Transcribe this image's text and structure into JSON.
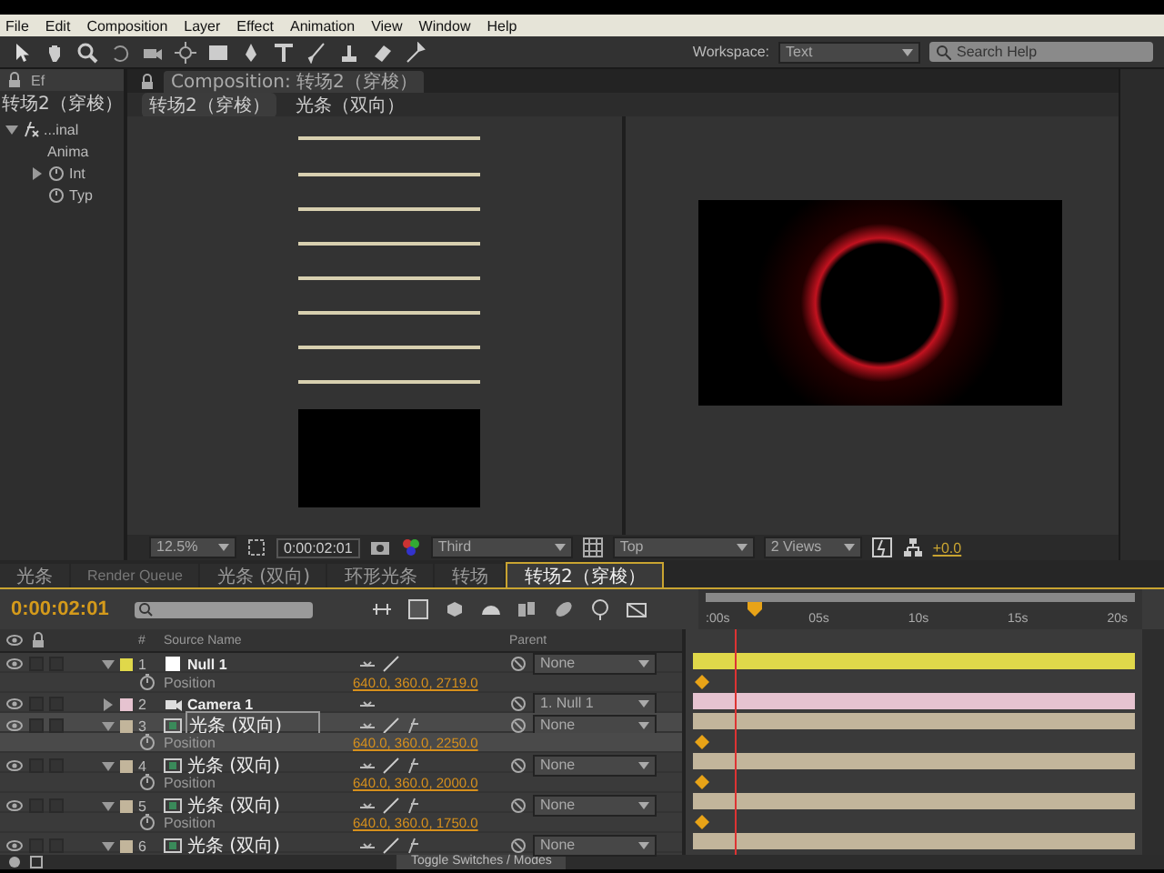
{
  "menu": [
    "File",
    "Edit",
    "Composition",
    "Layer",
    "Effect",
    "Animation",
    "View",
    "Window",
    "Help"
  ],
  "toolbar": {
    "workspace_label": "Workspace:",
    "workspace": "Text",
    "search_placeholder": "Search Help"
  },
  "effects_panel": {
    "tab": "Ef",
    "layer": "转场2（穿梭）",
    "tree": [
      {
        "label": "...inal",
        "kind": "effect",
        "expanded": true,
        "children": [
          {
            "label": "Anima",
            "kind": "group"
          },
          {
            "label": "Int",
            "kind": "property",
            "expanded": false
          },
          {
            "label": "Typ",
            "kind": "property"
          }
        ]
      }
    ]
  },
  "composition": {
    "tab": "Composition: 转场2（穿梭）",
    "breadcrumbs": [
      "转场2（穿梭）",
      "光条（双向）"
    ],
    "footer": {
      "zoom": "12.5%",
      "timecode": "0:00:02:01",
      "camera_view": "Third",
      "view": "Top",
      "layout": "2 Views",
      "exposure": "+0.0"
    }
  },
  "timeline_tabs": [
    {
      "label": "光条",
      "selected": false
    },
    {
      "label": "Render Queue",
      "selected": false
    },
    {
      "label": "光条 (双向)",
      "selected": false
    },
    {
      "label": "环形光条",
      "selected": false
    },
    {
      "label": "转场",
      "selected": false
    },
    {
      "label": "转场2（穿梭）",
      "selected": true
    }
  ],
  "timeline": {
    "current_time": "0:00:02:01",
    "ruler": [
      ":00s",
      "05s",
      "10s",
      "15s",
      "20s"
    ],
    "columns": {
      "number": "#",
      "source_name": "Source Name",
      "parent": "Parent"
    },
    "rows": [
      {
        "kind": "null_layer",
        "number": "1",
        "name": "Null 1",
        "color": "#e0d84a",
        "expanded": true,
        "selected": false,
        "parent": "None"
      },
      {
        "kind": "property",
        "name": "Position",
        "value": "640.0, 360.0, 2719.0",
        "keyframes": true,
        "selected": false
      },
      {
        "kind": "camera_layer",
        "number": "2",
        "name": "Camera 1",
        "color": "#e6c3d0",
        "expanded": false,
        "selected": false,
        "parent": "1. Null 1"
      },
      {
        "kind": "comp_layer",
        "number": "3",
        "name": "光条 (双向)",
        "color": "#c2b59b",
        "expanded": true,
        "selected": true,
        "parent": "None"
      },
      {
        "kind": "property",
        "name": "Position",
        "value": "640.0, 360.0, 2250.0",
        "keyframes": true,
        "selected": true
      },
      {
        "kind": "comp_layer",
        "number": "4",
        "name": "光条 (双向)",
        "color": "#c2b59b",
        "expanded": true,
        "selected": false,
        "parent": "None"
      },
      {
        "kind": "property",
        "name": "Position",
        "value": "640.0, 360.0, 2000.0",
        "keyframes": true,
        "selected": false
      },
      {
        "kind": "comp_layer",
        "number": "5",
        "name": "光条 (双向)",
        "color": "#c2b59b",
        "expanded": true,
        "selected": false,
        "parent": "None"
      },
      {
        "kind": "property",
        "name": "Position",
        "value": "640.0, 360.0, 1750.0",
        "keyframes": true,
        "selected": false
      },
      {
        "kind": "comp_layer",
        "number": "6",
        "name": "光条 (双向)",
        "color": "#c2b59b",
        "expanded": true,
        "selected": false,
        "parent": "None"
      }
    ],
    "toggle_button": "Toggle Switches / Modes"
  }
}
